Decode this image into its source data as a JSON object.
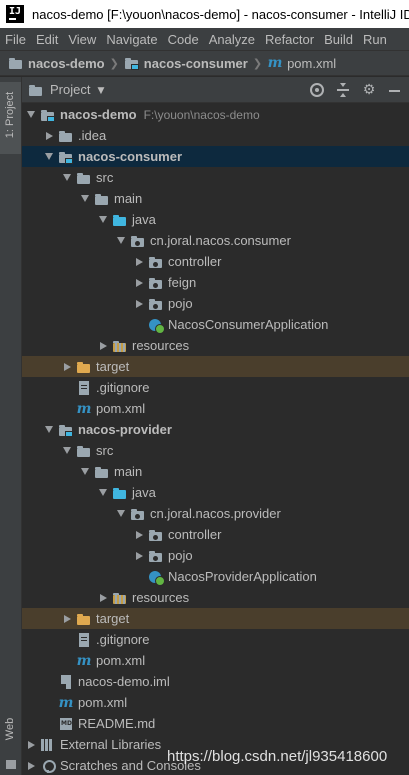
{
  "window": {
    "title": "nacos-demo [F:\\youon\\nacos-demo] - nacos-consumer - IntelliJ IDEA",
    "logo_text": "IJ"
  },
  "menu": [
    "File",
    "Edit",
    "View",
    "Navigate",
    "Code",
    "Analyze",
    "Refactor",
    "Build",
    "Run"
  ],
  "breadcrumb": [
    {
      "label": "nacos-demo",
      "icon": "folder-icon"
    },
    {
      "label": "nacos-consumer",
      "icon": "module-folder-icon"
    },
    {
      "label": "pom.xml",
      "icon": "maven-icon"
    }
  ],
  "sidebar": {
    "project_tab": "1: Project",
    "web_tab": "Web"
  },
  "panel": {
    "title": "Project"
  },
  "tree": {
    "root": {
      "label": "nacos-demo",
      "path": "F:\\youon\\nacos-demo"
    },
    "idea": ".idea",
    "consumer": {
      "label": "nacos-consumer",
      "src": "src",
      "main": "main",
      "java": "java",
      "package": "cn.joral.nacos.consumer",
      "controller": "controller",
      "feign": "feign",
      "pojo": "pojo",
      "app": "NacosConsumerApplication",
      "resources": "resources",
      "target": "target",
      "gitignore": ".gitignore",
      "pom": "pom.xml"
    },
    "provider": {
      "label": "nacos-provider",
      "src": "src",
      "main": "main",
      "java": "java",
      "package": "cn.joral.nacos.provider",
      "controller": "controller",
      "pojo": "pojo",
      "app": "NacosProviderApplication",
      "resources": "resources",
      "target": "target",
      "gitignore": ".gitignore",
      "pom": "pom.xml"
    },
    "iml": "nacos-demo.iml",
    "pom": "pom.xml",
    "readme": "README.md",
    "external_libraries": "External Libraries",
    "scratches": "Scratches and Consoles"
  },
  "watermark": "https://blog.csdn.net/jl935418600",
  "colors": {
    "selection": "#0d293e",
    "excluded_folder_bg": "#4a3e2c",
    "source_folder": "#40b6e0",
    "excluded_text": "#e0a94f"
  }
}
